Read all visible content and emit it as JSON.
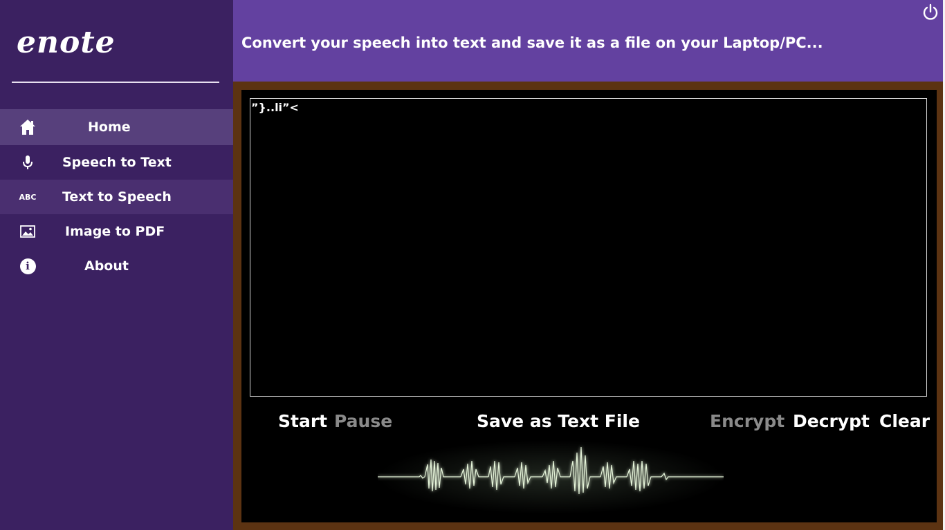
{
  "app": {
    "logo": "enote"
  },
  "sidebar": {
    "items": [
      {
        "label": "Home",
        "icon": "home-icon"
      },
      {
        "label": "Speech to Text",
        "icon": "microphone-icon"
      },
      {
        "label": "Text to Speech",
        "icon": "abc-icon",
        "icon_text": "ABC"
      },
      {
        "label": "Image to PDF",
        "icon": "image-icon"
      },
      {
        "label": "About",
        "icon": "info-icon",
        "icon_text": "i"
      }
    ]
  },
  "header": {
    "title": "Convert your speech into text and save it as a file on your Laptop/PC...",
    "power_icon": "power-icon"
  },
  "editor": {
    "value": "”}..li”<"
  },
  "controls": {
    "start": "Start",
    "pause": "Pause",
    "save": "Save as Text File",
    "encrypt": "Encrypt",
    "decrypt": "Decrypt",
    "clear": "Clear"
  },
  "colors": {
    "sidebar": "#3b2161",
    "active": "#57407c",
    "header": "#6341a0",
    "frame": "#5c3312",
    "disabled": "#8a8a8a",
    "wave": "#e6f5da"
  }
}
